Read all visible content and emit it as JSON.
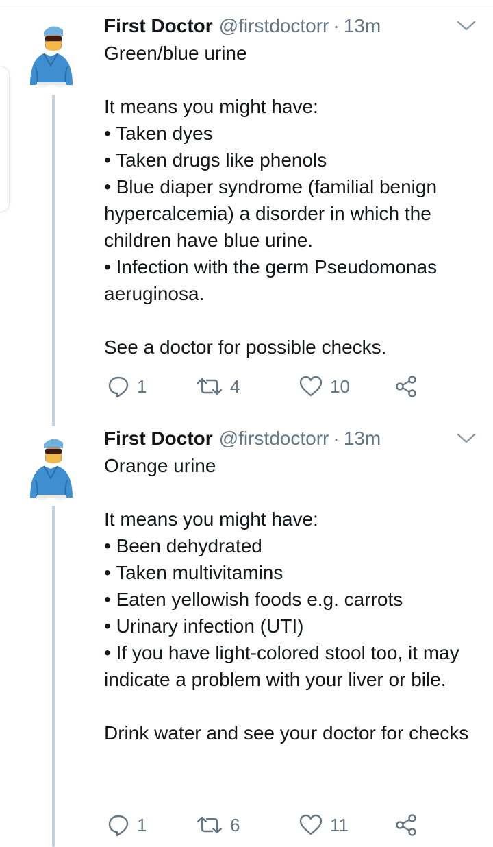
{
  "tweets": [
    {
      "author_name": "First Doctor",
      "handle": "@firstdoctorr",
      "separator": "·",
      "time": "13m",
      "text": "Green/blue urine\n\nIt means you might have:\n• Taken dyes\n• Taken drugs like phenols\n• Blue diaper syndrome (familial benign hypercalcemia) a disorder in which the children have blue urine.\n• Infection with the germ Pseudomonas aeruginosa.\n\nSee a doctor for possible checks.",
      "replies": "1",
      "retweets": "4",
      "likes": "10"
    },
    {
      "author_name": "First Doctor",
      "handle": "@firstdoctorr",
      "separator": "·",
      "time": "13m",
      "text": "Orange urine\n\nIt means you might have:\n• Been dehydrated\n• Taken multivitamins\n• Eaten yellowish foods e.g. carrots\n• Urinary infection (UTI)\n• If you have light-colored stool too, it may indicate a problem with your liver or bile.\n\nDrink water and see your doctor for checks",
      "replies": "1",
      "retweets": "6",
      "likes": "11"
    }
  ],
  "icons": {
    "reply": "reply-icon",
    "retweet": "retweet-icon",
    "like": "heart-icon",
    "share": "share-icon",
    "menu": "chevron-down-icon"
  },
  "colors": {
    "text": "#14171a",
    "secondary": "#657786",
    "thread_line": "#c4d2dc",
    "scrub_blue": "#3f8fd0"
  }
}
